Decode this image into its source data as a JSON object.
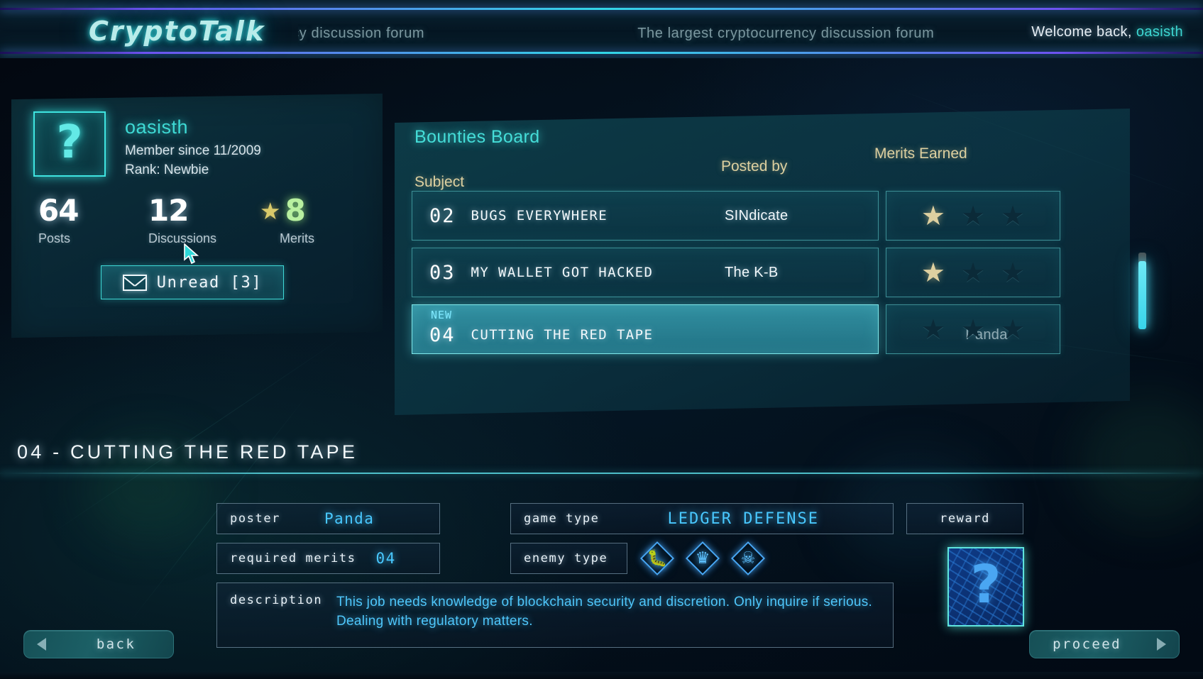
{
  "header": {
    "logo": "CryptoTalk",
    "marquee": "The largest cryptocurrency discussion forum",
    "welcome_prefix": "Welcome back,",
    "welcome_user": "oasisth"
  },
  "profile": {
    "avatar_icon": "question-mark-icon",
    "username": "oasisth",
    "member_since": "Member since 11/2009",
    "rank": "Rank: Newbie",
    "stats": [
      {
        "value": "64",
        "label": "Posts"
      },
      {
        "value": "12",
        "label": "Discussions"
      },
      {
        "value": "8",
        "label": "Merits"
      }
    ],
    "unread_label": "Unread [3]",
    "unread_icon": "envelope-icon"
  },
  "bounties": {
    "title": "Bounties Board",
    "columns": {
      "subject": "Subject",
      "posted_by": "Posted by",
      "merits": "Merits Earned"
    },
    "rows": [
      {
        "num": "02",
        "subject": "BUGS EVERYWHERE",
        "poster": "SINdicate",
        "merits_earned": 1,
        "merits_total": 3,
        "new": false,
        "selected": false
      },
      {
        "num": "03",
        "subject": "MY WALLET GOT HACKED",
        "poster": "The K-B",
        "merits_earned": 1,
        "merits_total": 3,
        "new": false,
        "selected": false
      },
      {
        "num": "04",
        "subject": "CUTTING THE RED TAPE",
        "poster": "Panda",
        "merits_earned": 0,
        "merits_total": 3,
        "new": true,
        "selected": true,
        "new_badge": "NEW"
      }
    ]
  },
  "detail": {
    "title": "04 - CUTTING THE RED TAPE",
    "poster_label": "poster",
    "poster_value": "Panda",
    "required_merits_label": "required merits",
    "required_merits_value": "04",
    "game_type_label": "game type",
    "game_type_value": "LEDGER DEFENSE",
    "enemy_type_label": "enemy type",
    "enemy_icons": [
      "bug-icon",
      "spy-hat-icon",
      "skull-icon"
    ],
    "reward_label": "reward",
    "reward_icon": "circuit-question-mark-icon",
    "description_label": "description",
    "description_text": "This job needs knowledge of blockchain security and discretion. Only inquire if serious. Dealing with regulatory matters."
  },
  "buttons": {
    "back": "back",
    "proceed": "proceed"
  },
  "colors": {
    "accent_cyan": "#3ed7d2",
    "accent_blue": "#49c8ff",
    "gold_star": "#ded0a0",
    "dark_star": "#0b2a38",
    "panel_teal": "#104a5e"
  }
}
